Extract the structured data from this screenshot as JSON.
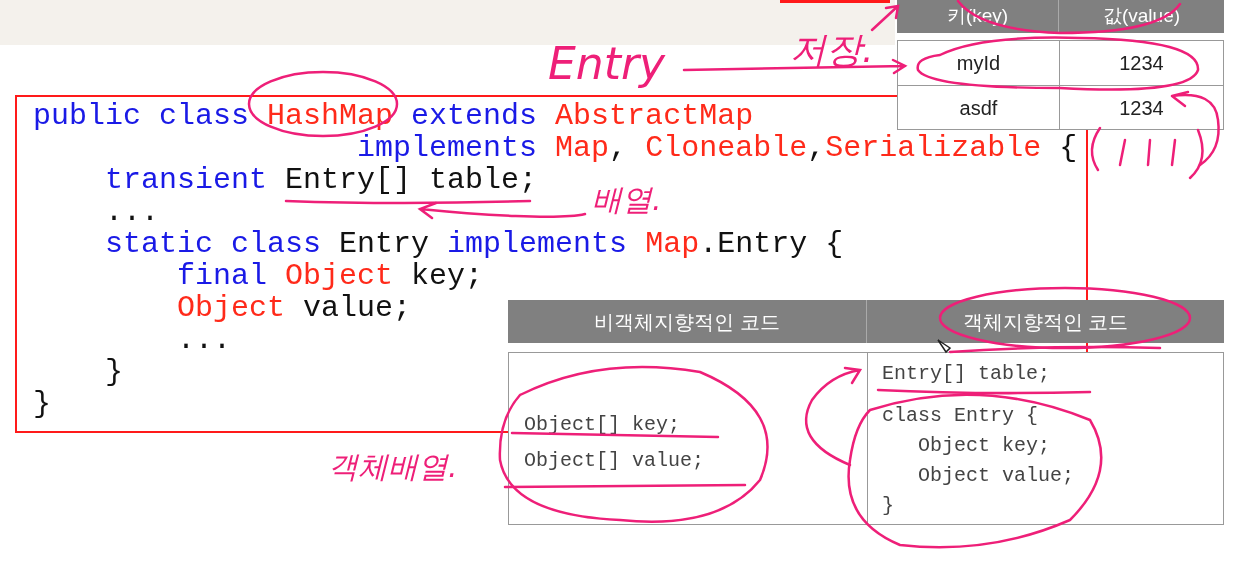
{
  "code_lines": [
    {
      "tokens": [
        {
          "text": "public class ",
          "kind": "keyword"
        },
        {
          "text": "HashMap",
          "kind": "type"
        },
        {
          "text": " extends ",
          "kind": "keyword"
        },
        {
          "text": "AbstractMap",
          "kind": "type"
        }
      ]
    },
    {
      "tokens": [
        {
          "text": "                  implements ",
          "kind": "keyword"
        },
        {
          "text": "Map",
          "kind": "type"
        },
        {
          "text": ", ",
          "kind": "plain"
        },
        {
          "text": "Cloneable",
          "kind": "type"
        },
        {
          "text": ",",
          "kind": "plain"
        },
        {
          "text": "Serializable",
          "kind": "type"
        },
        {
          "text": " {",
          "kind": "plain"
        }
      ]
    },
    {
      "tokens": [
        {
          "text": "    transient ",
          "kind": "keyword"
        },
        {
          "text": "Entry[] table;",
          "kind": "plain"
        }
      ]
    },
    {
      "tokens": [
        {
          "text": "    ...",
          "kind": "plain"
        }
      ]
    },
    {
      "tokens": [
        {
          "text": "    static class ",
          "kind": "keyword"
        },
        {
          "text": "Entry ",
          "kind": "plain"
        },
        {
          "text": "implements ",
          "kind": "keyword"
        },
        {
          "text": "Map",
          "kind": "type"
        },
        {
          "text": ".Entry {",
          "kind": "plain"
        }
      ]
    },
    {
      "tokens": [
        {
          "text": "        final ",
          "kind": "keyword"
        },
        {
          "text": "Object",
          "kind": "type"
        },
        {
          "text": " key;",
          "kind": "plain"
        }
      ]
    },
    {
      "tokens": [
        {
          "text": "        Object",
          "kind": "type"
        },
        {
          "text": " value;",
          "kind": "plain"
        }
      ]
    },
    {
      "tokens": [
        {
          "text": "        ...",
          "kind": "plain"
        }
      ]
    },
    {
      "tokens": [
        {
          "text": "    }",
          "kind": "plain"
        }
      ]
    },
    {
      "tokens": [
        {
          "text": "}",
          "kind": "plain"
        }
      ]
    }
  ],
  "key_value_table": {
    "columns": [
      "키(key)",
      "값(value)"
    ],
    "rows": [
      [
        "myId",
        "1234"
      ],
      [
        "asdf",
        "1234"
      ]
    ]
  },
  "comparison_table": {
    "columns": [
      "비객체지향적인 코드",
      "객체지향적인 코드"
    ],
    "cells": [
      [
        "Object[] key;",
        "Object[] value;"
      ],
      [
        "Entry[] table;",
        "class Entry {",
        "   Object key;",
        "   Object value;",
        "}"
      ]
    ]
  },
  "annotations": [
    {
      "text": "Entry"
    },
    {
      "text": "저장."
    },
    {
      "text": "배열."
    },
    {
      "text": "객체배열."
    }
  ]
}
